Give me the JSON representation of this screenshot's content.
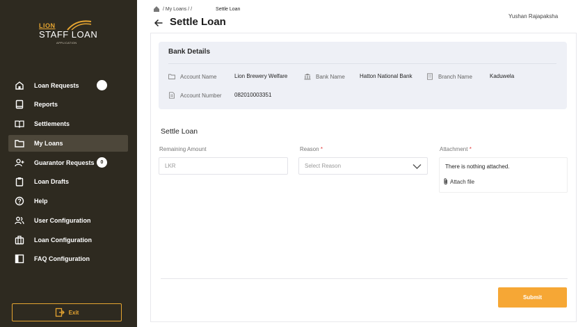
{
  "app": {
    "logo_lion": "LION",
    "logo_staff_loan": "STAFF LOAN",
    "logo_sub": "APPLICATION"
  },
  "sidebar": {
    "items": [
      {
        "label": "Loan Requests",
        "icon": "home-icon"
      },
      {
        "label": "Reports",
        "icon": "report-icon"
      },
      {
        "label": "Settlements",
        "icon": "book-icon"
      },
      {
        "label": "My Loans",
        "icon": "folder-icon"
      },
      {
        "label": "Guarantor Requests",
        "icon": "user-plus-icon",
        "badge": "0"
      },
      {
        "label": "Loan Drafts",
        "icon": "clipboard-icon"
      },
      {
        "label": "Help",
        "icon": "help-icon"
      },
      {
        "label": "User Configuration",
        "icon": "users-icon"
      },
      {
        "label": "Loan Configuration",
        "icon": "briefcase-icon"
      },
      {
        "label": "FAQ Configuration",
        "icon": "panel-icon"
      }
    ],
    "active_index": 3,
    "exit_label": "Exit"
  },
  "header": {
    "breadcrumb_links": "/ My Loans / /",
    "breadcrumb_current": "Settle Loan",
    "title": "Settle Loan",
    "user_name": "Yushan Rajapaksha"
  },
  "bank_details": {
    "title": "Bank Details",
    "account_name_label": "Account Name",
    "account_name": "Lion Brewery Welfare",
    "bank_name_label": "Bank Name",
    "bank_name": "Hatton National Bank",
    "branch_name_label": "Branch Name",
    "branch_name": "Kaduwela",
    "account_number_label": "Account Number",
    "account_number": "082010003351"
  },
  "settle_form": {
    "title": "Settle Loan",
    "remaining_amount_label": "Remaining Amount",
    "remaining_amount_placeholder": "LKR",
    "reason_label": "Reason",
    "reason_placeholder": "Select Reason",
    "attachment_label": "Attachment",
    "required_mark": "*",
    "attachment_empty": "There is nothing attached.",
    "attach_file_label": "Attach file",
    "submit_label": "Submit"
  },
  "colors": {
    "sidebar_bg": "#2e2a20",
    "accent": "#f6a735",
    "required": "#e23d3d"
  }
}
